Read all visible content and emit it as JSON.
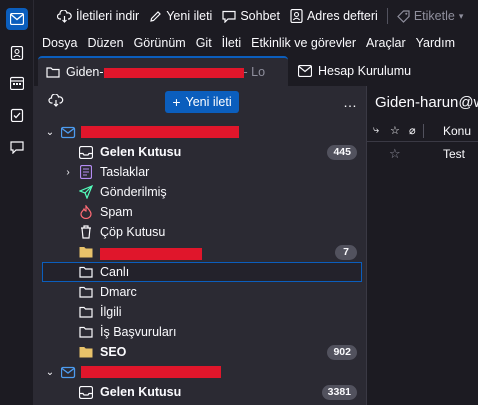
{
  "toolbar": {
    "get_messages": "İletileri indir",
    "new_message": "Yeni ileti",
    "chat": "Sohbet",
    "address_book": "Adres defteri",
    "tag": "Etiketle"
  },
  "menubar": [
    "Dosya",
    "Düzen",
    "Görünüm",
    "Git",
    "İleti",
    "Etkinlik ve görevler",
    "Araçlar",
    "Yardım"
  ],
  "tabs": {
    "active": {
      "prefix": "Giden-",
      "suffix": "- Lo"
    },
    "second": {
      "label": "Hesap Kurulumu"
    }
  },
  "folder_pane": {
    "new_message_button": "Yeni ileti",
    "more": "…",
    "account1": {
      "folders": [
        {
          "label": "Gelen Kutusu",
          "bold": true,
          "count": "445",
          "icon": "inbox-icon"
        },
        {
          "label": "Taslaklar",
          "bold": false,
          "icon": "drafts-icon"
        },
        {
          "label": "Gönderilmiş",
          "bold": false,
          "icon": "sent-icon"
        },
        {
          "label": "Spam",
          "bold": false,
          "icon": "spam-icon"
        },
        {
          "label": "Çöp Kutusu",
          "bold": false,
          "icon": "trash-icon"
        },
        {
          "label": "",
          "bold": false,
          "count": "7",
          "icon": "folder-icon"
        },
        {
          "label": "Canlı",
          "bold": false,
          "icon": "folder-icon",
          "selected": true
        },
        {
          "label": "Dmarc",
          "bold": false,
          "icon": "folder-icon"
        },
        {
          "label": "İlgili",
          "bold": false,
          "icon": "folder-icon"
        },
        {
          "label": "İş Başvuruları",
          "bold": false,
          "icon": "folder-icon"
        },
        {
          "label": "SEO",
          "bold": true,
          "count": "902",
          "icon": "folder-icon"
        }
      ]
    },
    "account2": {
      "folders": [
        {
          "label": "Gelen Kutusu",
          "bold": true,
          "count": "3381",
          "icon": "inbox-icon"
        }
      ]
    }
  },
  "message_list": {
    "title": "Giden-harun@w",
    "column_subject": "Konu",
    "rows": [
      {
        "subject": "Test"
      }
    ]
  },
  "colors": {
    "accent": "#0b5ebd",
    "redaction": "#e0162b",
    "pane_bg": "#2b2a33",
    "bg": "#1c1b22"
  }
}
